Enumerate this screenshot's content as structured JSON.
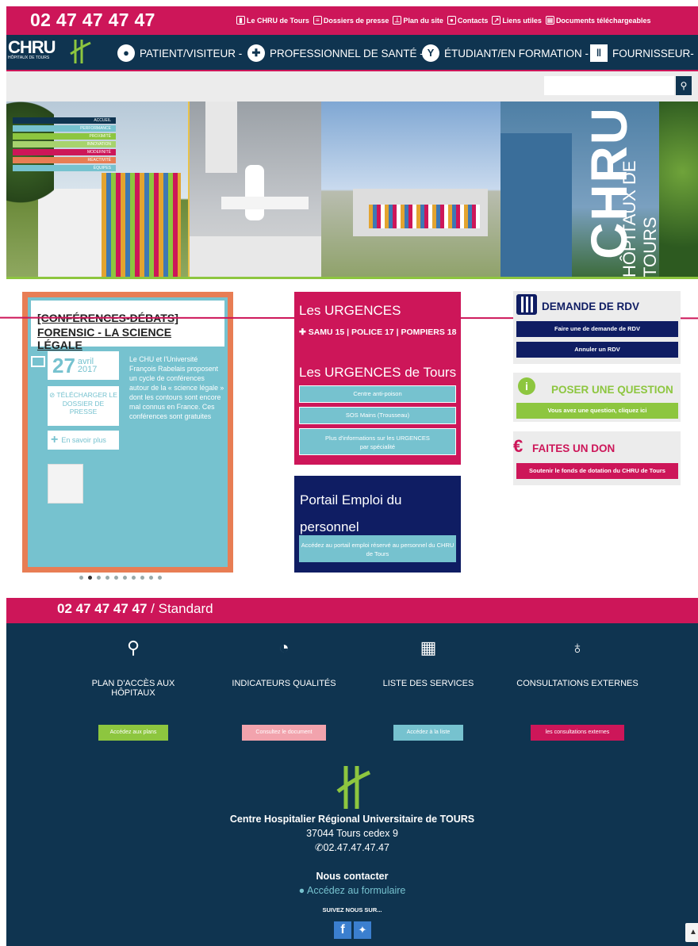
{
  "topbar": {
    "phone": "02 47 47 47 47",
    "links": [
      {
        "label": "Le CHRU de Tours",
        "icon": "chart-icon"
      },
      {
        "label": "Dossiers de presse",
        "icon": "newspaper-icon"
      },
      {
        "label": "Plan du site",
        "icon": "sitemap-icon"
      },
      {
        "label": "Contacts",
        "icon": "users-icon"
      },
      {
        "label": "Liens utiles",
        "icon": "external-link-icon"
      },
      {
        "label": "Documents téléchargeables",
        "icon": "document-icon"
      }
    ]
  },
  "nav": {
    "logo_text": "CHRU",
    "logo_sub": "HÔPITAUX DE TOURS",
    "items": [
      {
        "label": "PATIENT/VISITEUR -",
        "icon": "user-icon"
      },
      {
        "label": "PROFESSIONNEL DE SANTÉ -",
        "icon": "doctor-icon"
      },
      {
        "label": "ÉTUDIANT/EN FORMATION -",
        "icon": "student-icon"
      },
      {
        "label": "FOURNISSEUR-",
        "icon": "barcode-icon"
      }
    ]
  },
  "search": {
    "placeholder": "",
    "button_icon": "search-icon"
  },
  "banner": {
    "menu": [
      "ACCUEIL",
      "PERFORMANCE",
      "PROXIMITÉ",
      "INNOVATION",
      "MODERNITÉ",
      "RÉACTIVITÉ",
      "ÉQUIPES"
    ],
    "big_text": "CHRU",
    "sub_text": "HÔPITAUX DE TOURS"
  },
  "news": {
    "category": "[CONFÉRENCES-DÉBATS]",
    "title": "FORENSIC - LA SCIENCE LÉGALE",
    "day": "27",
    "month": "avril",
    "year": "2017",
    "text": "Le CHU et l'Université François Rabelais proposent un cycle de conférences autour de la « science légale » dont les contours sont encore mal connus en France. Ces conférences sont gratuites",
    "download_label": "TÉLÉCHARGER LE DOSSIER DE PRESSE",
    "more_label": "En savoir plus",
    "slides": 10,
    "active_slide": 2
  },
  "urgences": {
    "title": "Les URGENCES",
    "numbers": "SAMU 15  |  POLICE 17  |  POMPIERS 18",
    "subtitle": "Les URGENCES de Tours",
    "buttons": [
      "Centre anti-poison",
      "SOS Mains (Trousseau)",
      "Plus d'informations sur les URGENCES par spécialité"
    ]
  },
  "emploi": {
    "title": "Portail Emploi du personnel",
    "button": "Accédez au portail emploi réservé au personnel du CHRU de Tours"
  },
  "rdv": {
    "title": "DEMANDE DE RDV",
    "buttons": [
      "Faire une de demande de RDV",
      "Annuler un RDV"
    ]
  },
  "question": {
    "title": "POSER UNE QUESTION",
    "button": "Vous avez une question, cliquez ici"
  },
  "don": {
    "title": "FAITES UN DON",
    "button": "Soutenir le fonds de dotation du CHRU de Tours"
  },
  "standard": {
    "phone": "02 47 47 47 47",
    "suffix": " / Standard"
  },
  "footer": {
    "cols": [
      {
        "label": "PLAN D'ACCÈS AUX HÔPITAUX",
        "button": "Accédez aux plans",
        "icon": "map-pin-icon",
        "color": "#8dc63f"
      },
      {
        "label": "INDICATEURS QUALITÉS",
        "button": "Consultez le document",
        "icon": "dashboard-icon",
        "color": "#f2a3ad"
      },
      {
        "label": "LISTE DES SERVICES",
        "button": "Accédez à la liste",
        "icon": "hospital-icon",
        "color": "#76c2cf"
      },
      {
        "label": "CONSULTATIONS EXTERNES",
        "button": "les consultations externes",
        "icon": "stethoscope-icon",
        "color": "#cd1659"
      }
    ],
    "org": "Centre Hospitalier Régional Universitaire de TOURS",
    "address": "37044 Tours cedex 9",
    "phone": "02.47.47.47.47",
    "contact_title": "Nous contacter",
    "contact_link": "Accédez au formulaire",
    "social_label": "SUIVEZ NOUS SUR..."
  },
  "colors": {
    "brand_pink": "#cd1659",
    "navy": "#0f3450",
    "teal": "#76c2cf",
    "green": "#8dc63f",
    "orange": "#e87d54",
    "dark_blue": "#0f1d63"
  }
}
